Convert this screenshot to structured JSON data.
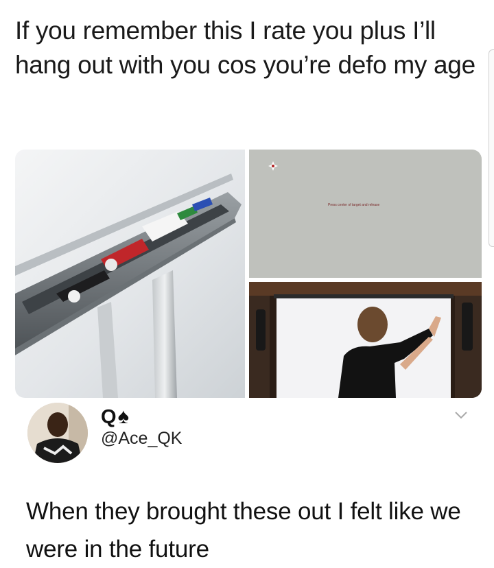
{
  "post": {
    "headline": "If you remember this I rate you plus I’ll hang out with you cos you’re defo my age"
  },
  "images": {
    "calibration_text": "Press center of target and release"
  },
  "tweet": {
    "display_name": "Q",
    "name_emoji": "♠",
    "handle": "@Ace_QK",
    "body": "When they brought these out I felt like we were in the future"
  },
  "icons": {
    "chevron": "chevron-down-icon",
    "target": "crosshair-target-icon"
  }
}
